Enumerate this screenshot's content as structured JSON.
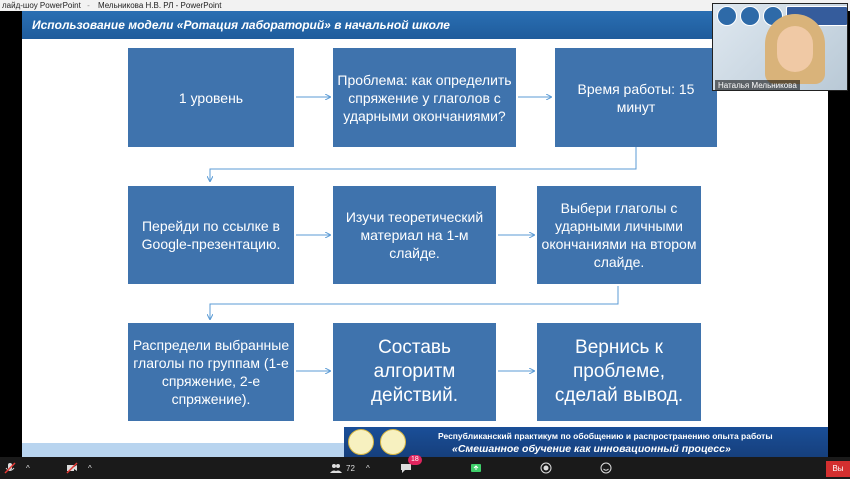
{
  "titlebar": {
    "app": "лайд-шоу PowerPoint",
    "doc": "Мельникова Н.В. РЛ - PowerPoint"
  },
  "slide": {
    "header": "Использование модели «Ротация лабораторий» в начальной школе",
    "boxes": [
      "1 уровень",
      "Проблема: как определить спряжение у глаголов с ударными окончаниями?",
      "Время работы: 15 минут",
      "Перейди по ссылке в Google-презентацию.",
      "Изучи теоретический материал на 1-м слайде.",
      "Выбери глаголы с ударными личными окончаниями на втором слайде.",
      "Распредели выбранные глаголы по группам (1-е спряжение, 2-е спряжение).",
      "Составь алгоритм действий.",
      "Вернись к проблеме, сделай вывод."
    ],
    "footer": {
      "line1": "Республиканский практикум по обобщению и распространению опыта работы",
      "line2": "«Смешанное обучение как инновационный процесс»"
    }
  },
  "video": {
    "participant_name": "Наталья Мельникова"
  },
  "taskbar": {
    "participants_count": "72",
    "chat_badge": "18",
    "end_label": "Вы"
  },
  "colors": {
    "box_blue": "#3f73ad",
    "header_blue": "#1f5c9c",
    "arrow": "#5b9bd5"
  }
}
